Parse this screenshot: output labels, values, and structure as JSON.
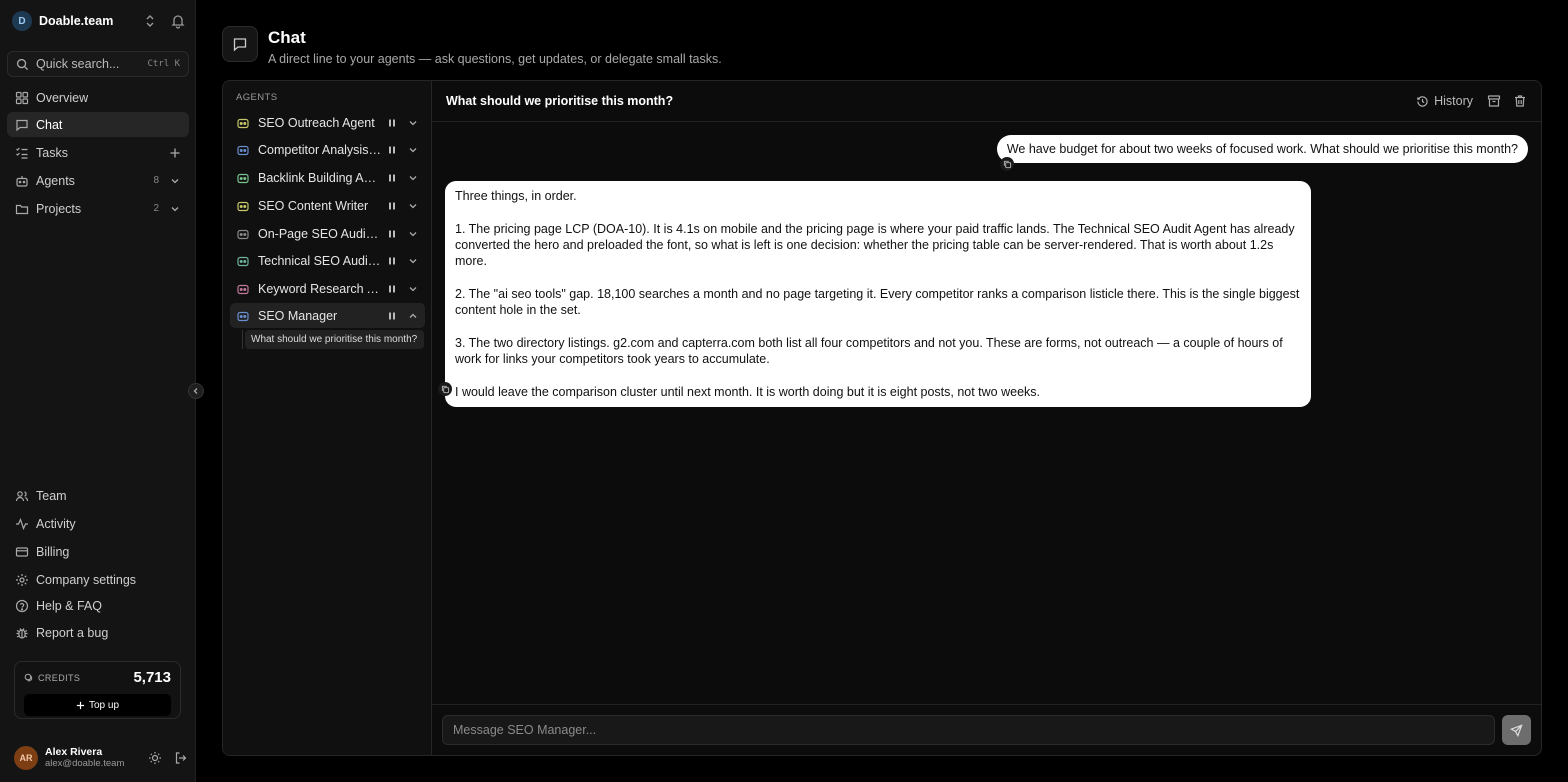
{
  "workspace": {
    "initial": "D",
    "name": "Doable.team"
  },
  "search": {
    "label": "Quick search...",
    "shortcut": "Ctrl K"
  },
  "nav": {
    "overview": "Overview",
    "chat": "Chat",
    "tasks": "Tasks",
    "agents": {
      "label": "Agents",
      "count": "8"
    },
    "projects": {
      "label": "Projects",
      "count": "2"
    }
  },
  "bottom_nav": {
    "team": "Team",
    "activity": "Activity",
    "billing": "Billing",
    "company_settings": "Company settings",
    "help": "Help & FAQ",
    "report_bug": "Report a bug"
  },
  "credits": {
    "label": "CREDITS",
    "value": "5,713",
    "topup": "Top up"
  },
  "user": {
    "initials": "AR",
    "name": "Alex Rivera",
    "email": "alex@doable.team"
  },
  "page": {
    "title": "Chat",
    "subtitle": "A direct line to your agents — ask questions, get updates, or delegate small tasks."
  },
  "agents_panel": {
    "heading": "AGENTS",
    "agents": [
      {
        "name": "SEO Outreach Agent",
        "color": "#c8c86a"
      },
      {
        "name": "Competitor Analysis Agent",
        "color": "#6a8fd0"
      },
      {
        "name": "Backlink Building Agent",
        "color": "#7ac48f"
      },
      {
        "name": "SEO Content Writer",
        "color": "#c8c86a"
      },
      {
        "name": "On-Page SEO Audit Agent",
        "color": "#8a8a8a"
      },
      {
        "name": "Technical SEO Audit Agent",
        "color": "#6fb39a"
      },
      {
        "name": "Keyword Research Agent",
        "color": "#c07a9a"
      },
      {
        "name": "SEO Manager",
        "color": "#6a8fd0"
      }
    ],
    "thread": "What should we prioritise this month?"
  },
  "chat": {
    "title": "What should we prioritise this month?",
    "history": "History",
    "user_message": "We have budget for about two weeks of focused work. What should we prioritise this month?",
    "reply": [
      "Three things, in order.",
      "1. The pricing page LCP (DOA-10). It is 4.1s on mobile and the pricing page is where your paid traffic lands. The Technical SEO Audit Agent has already converted the hero and preloaded the font, so what is left is one decision: whether the pricing table can be server-rendered. That is worth about 1.2s more.",
      "2. The \"ai seo tools\" gap. 18,100 searches a month and no page targeting it. Every competitor ranks a comparison listicle there. This is the single biggest content hole in the set.",
      "3. The two directory listings. g2.com and capterra.com both list all four competitors and not you. These are forms, not outreach — a couple of hours of work for links your competitors took years to accumulate.",
      "I would leave the comparison cluster until next month. It is worth doing but it is eight posts, not two weeks."
    ],
    "placeholder": "Message SEO Manager..."
  }
}
